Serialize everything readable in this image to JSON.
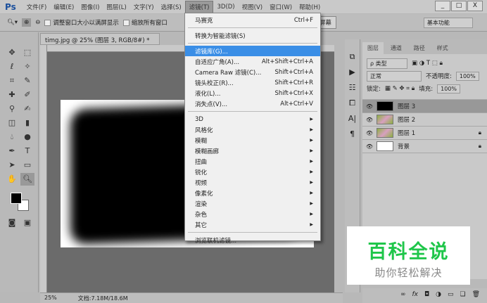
{
  "app": {
    "logo": "Ps"
  },
  "menubar": [
    "文件(F)",
    "编辑(E)",
    "图像(I)",
    "图层(L)",
    "文字(Y)",
    "选择(S)",
    "滤镜(T)",
    "3D(D)",
    "视图(V)",
    "窗口(W)",
    "帮助(H)"
  ],
  "window_buttons": [
    "_",
    "□",
    "X"
  ],
  "options": {
    "resize_window": "调整窗口大小以满屏显示",
    "zoom_all": "缩放所有窗口",
    "fill_screen": "填充屏幕",
    "workspace": "基本功能"
  },
  "document_tab": "timg.jpg @ 25% (图层 3, RGB/8#) * ×",
  "filter_menu": {
    "top": [
      {
        "label": "马赛克",
        "shortcut": "Ctrl+F"
      }
    ],
    "convert": "转换为智能滤镜(S)",
    "group2": [
      {
        "label": "滤镜库(G)...",
        "shortcut": ""
      },
      {
        "label": "自适应广角(A)...",
        "shortcut": "Alt+Shift+Ctrl+A"
      },
      {
        "label": "Camera Raw 滤镜(C)...",
        "shortcut": "Shift+Ctrl+A"
      },
      {
        "label": "镜头校正(R)...",
        "shortcut": "Shift+Ctrl+R"
      },
      {
        "label": "液化(L)...",
        "shortcut": "Shift+Ctrl+X"
      },
      {
        "label": "消失点(V)...",
        "shortcut": "Alt+Ctrl+V"
      }
    ],
    "submenus": [
      "3D",
      "风格化",
      "模糊",
      "模糊画廊",
      "扭曲",
      "锐化",
      "视频",
      "像素化",
      "渲染",
      "杂色",
      "其它"
    ],
    "browse": "浏览联机滤镜..."
  },
  "status": {
    "zoom": "25%",
    "doc": "文档:7.18M/18.6M"
  },
  "layers_panel": {
    "tabs": [
      "图层",
      "通道",
      "路径",
      "样式"
    ],
    "filter_kind": "ρ 类型",
    "blend_mode": "正常",
    "opacity_label": "不透明度:",
    "opacity": "100%",
    "lock_label": "锁定:",
    "fill_label": "填充:",
    "fill": "100%",
    "layers": [
      {
        "name": "图层 3",
        "selected": true,
        "locked": false
      },
      {
        "name": "图层 2",
        "selected": false,
        "locked": false
      },
      {
        "name": "图层 1",
        "selected": false,
        "locked": true
      },
      {
        "name": "背景",
        "selected": false,
        "locked": true
      }
    ]
  },
  "watermark": {
    "title": "百科全说",
    "subtitle": "助你轻松解决"
  },
  "colors": {
    "highlight": "#3a8ee6",
    "watermark_green": "#1fc64a"
  }
}
